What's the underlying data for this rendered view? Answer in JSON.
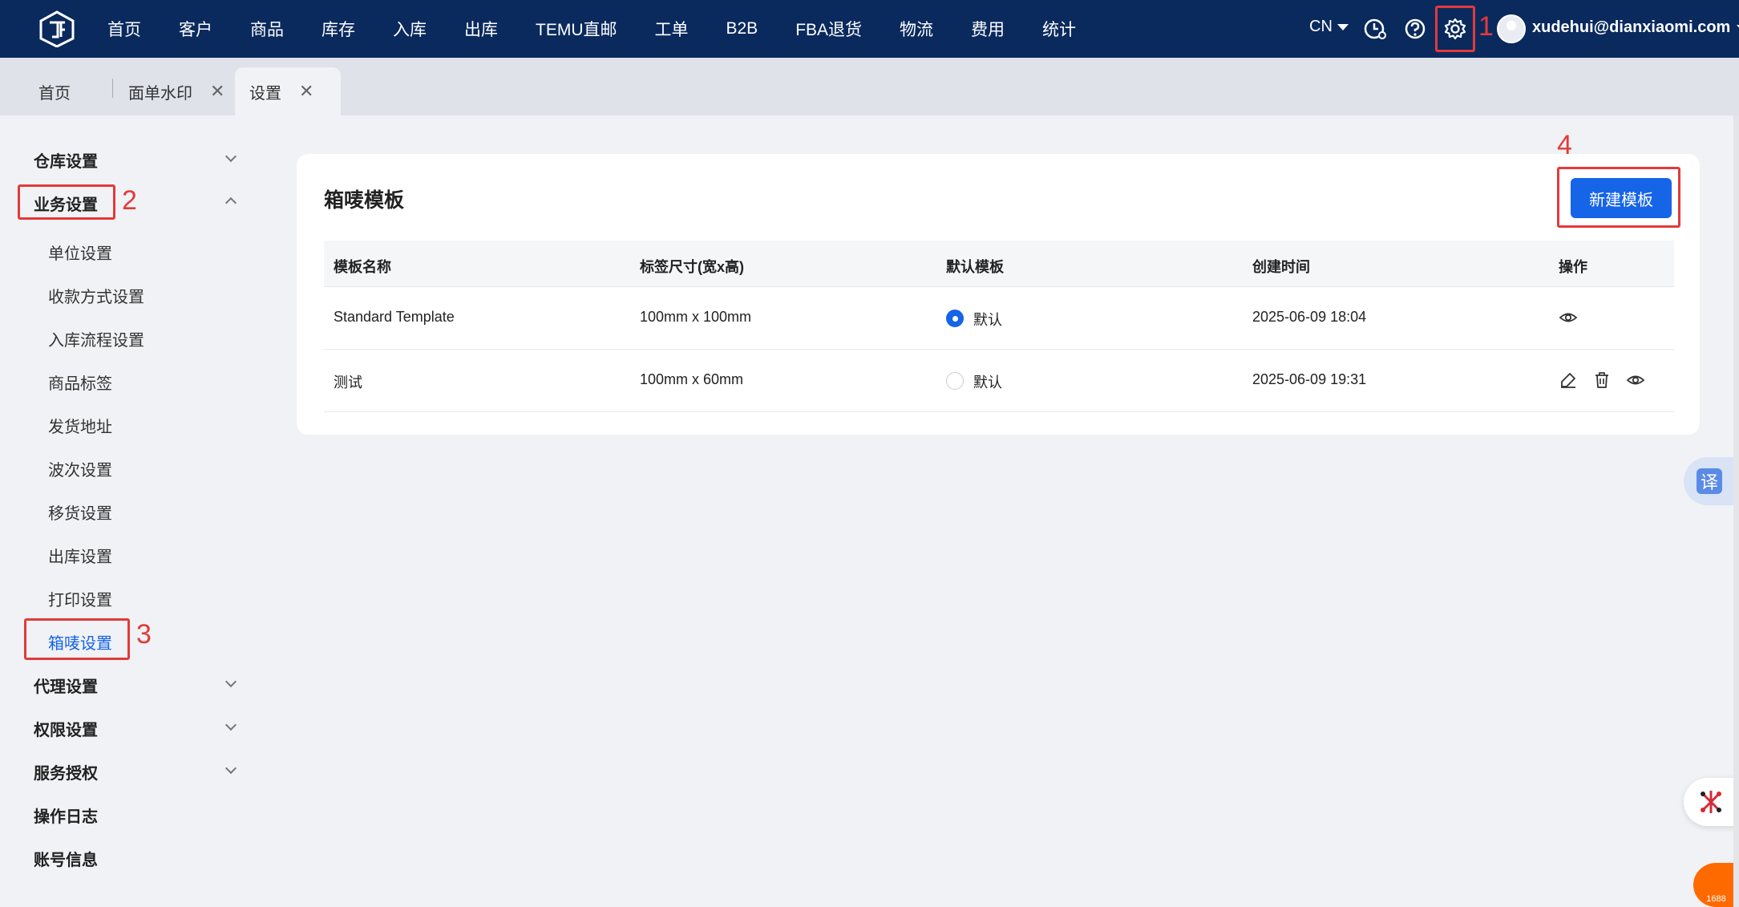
{
  "nav": {
    "items": [
      "首页",
      "客户",
      "商品",
      "库存",
      "入库",
      "出库",
      "TEMU直邮",
      "工单",
      "B2B",
      "FBA退货",
      "物流",
      "费用",
      "统计"
    ],
    "lang": "CN",
    "user_email": "xudehui@dianxiaomi.com"
  },
  "tabs": [
    {
      "label": "首页"
    },
    {
      "label": "面单水印"
    },
    {
      "label": "设置"
    }
  ],
  "annotations": {
    "n1": "1",
    "n2": "2",
    "n3": "3",
    "n4": "4"
  },
  "sidebar": {
    "warehouse": "仓库设置",
    "business": "业务设置",
    "business_items": [
      "单位设置",
      "收款方式设置",
      "入库流程设置",
      "商品标签",
      "发货地址",
      "波次设置",
      "移货设置",
      "出库设置",
      "打印设置",
      "箱唛设置"
    ],
    "agent": "代理设置",
    "permission": "权限设置",
    "service": "服务授权",
    "log": "操作日志",
    "account": "账号信息"
  },
  "card": {
    "title": "箱唛模板",
    "new_button": "新建模板"
  },
  "table": {
    "headers": [
      "模板名称",
      "标签尺寸(宽x高)",
      "默认模板",
      "创建时间",
      "操作"
    ],
    "rows": [
      {
        "name": "Standard Template",
        "size": "100mm x 100mm",
        "default_label": "默认",
        "is_default": true,
        "created": "2025-06-09 18:04"
      },
      {
        "name": "测试",
        "size": "100mm x 60mm",
        "default_label": "默认",
        "is_default": false,
        "created": "2025-06-09 19:31"
      }
    ]
  },
  "floating": {
    "translate": "译",
    "badge_1688": "1688"
  },
  "colors": {
    "topbar": "#0a2a5e",
    "accent": "#1664e8",
    "highlight": "#e23a3a"
  }
}
